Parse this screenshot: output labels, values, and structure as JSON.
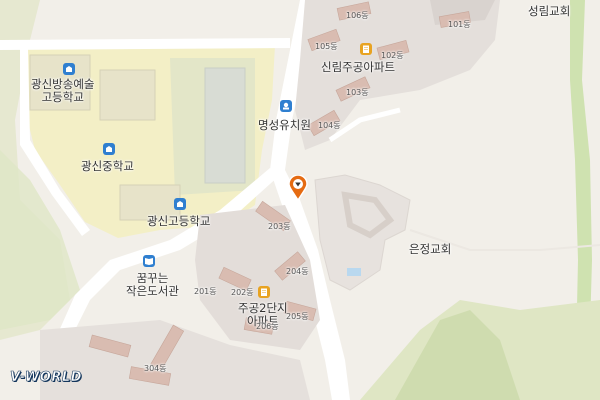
{
  "map": {
    "places": {
      "school_arts": "광신방송예술\n고등학교",
      "school_middle": "광신중학교",
      "school_high": "광신고등학교",
      "library": "꿈꾸는\n작은도서관",
      "kindergarten": "명성유치원",
      "apt_sillim": "신림주공아파트",
      "apt_jugong2": "주공2단지\n아파트",
      "church_eunjeong": "은정교회",
      "church_seongnim": "성림교회"
    },
    "buildings": {
      "b101": "101동",
      "b102": "102동",
      "b103": "103동",
      "b104": "104동",
      "b105": "105동",
      "b106": "106동",
      "b201": "201동",
      "b202": "202동",
      "b203": "203동",
      "b204": "204동",
      "b205": "205동",
      "b206": "206동",
      "b304": "304동"
    },
    "logo": "V-WORLD",
    "icons": {
      "school": "school-icon",
      "kindergarten": "kindergarten-icon",
      "library": "library-icon",
      "apartment": "apartment-icon",
      "marker": "location-pin-icon"
    },
    "colors": {
      "background": "#f2efe9",
      "school_ground": "#f3efc6",
      "field": "#e3e6c8",
      "green": "#d6e4bd",
      "road": "#ffffff",
      "building": "#d9bcb1",
      "apt_block": "#d2d0cc",
      "poi_blue": "#2f7fd0",
      "poi_orange": "#e8a321",
      "marker": "#e56b12"
    }
  }
}
